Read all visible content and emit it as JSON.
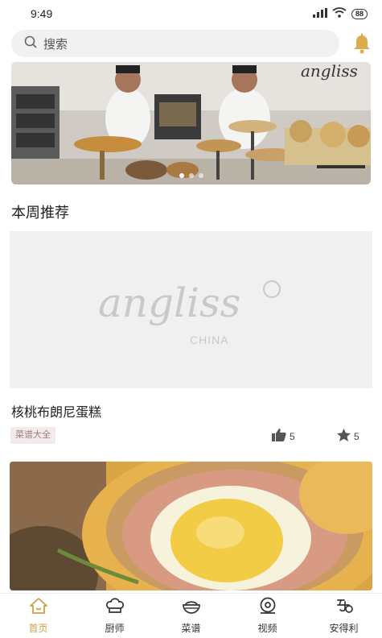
{
  "status_bar": {
    "time": "9:49",
    "battery": "88"
  },
  "search": {
    "placeholder": "搜索"
  },
  "banner": {
    "brand": "angliss"
  },
  "section": {
    "title": "本周推荐"
  },
  "card1": {
    "brand": "angliss",
    "brand_sub": "CHINA",
    "title": "核桃布朗尼蛋糕",
    "tag": "菜谱大全",
    "likes": "5",
    "favorites": "5"
  },
  "tabs": [
    {
      "label": "首页",
      "icon": "home-icon",
      "active": true
    },
    {
      "label": "厨师",
      "icon": "chef-hat-icon",
      "active": false
    },
    {
      "label": "菜谱",
      "icon": "recipe-bowl-icon",
      "active": false
    },
    {
      "label": "视频",
      "icon": "video-icon",
      "active": false
    },
    {
      "label": "安得利",
      "icon": "angliss-logo-icon",
      "active": false
    }
  ],
  "colors": {
    "accent": "#c9a24a",
    "tag_bg": "#f5e9ea",
    "search_bg": "#f1f1f1"
  }
}
